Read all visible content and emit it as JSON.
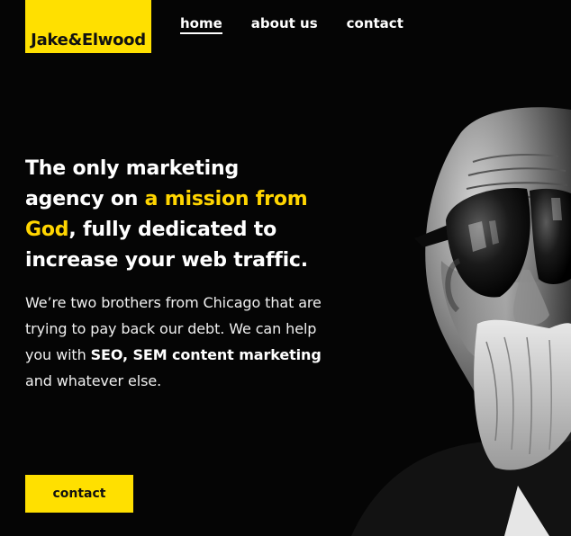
{
  "header": {
    "logo_text": "Jake&Elwood",
    "nav": [
      {
        "label": "home",
        "active": true
      },
      {
        "label": "about us",
        "active": false
      },
      {
        "label": "contact",
        "active": false
      }
    ]
  },
  "hero": {
    "headline_part1": "The only marketing agency on ",
    "headline_accent": "a mission from God",
    "headline_part2": ", fully dedicated to increase your web traffic.",
    "description_part1": "We’re two brothers from Chicago that are trying to pay back our debt. We can help you with ",
    "description_bold": "SEO, SEM content marketing",
    "description_part2": " and whatever else.",
    "cta_label": "contact"
  },
  "colors": {
    "accent": "#ffe000",
    "background": "#050505",
    "text": "#ffffff"
  },
  "images": {
    "portrait": "black-and-white portrait of a bald bearded man wearing sunglasses"
  }
}
